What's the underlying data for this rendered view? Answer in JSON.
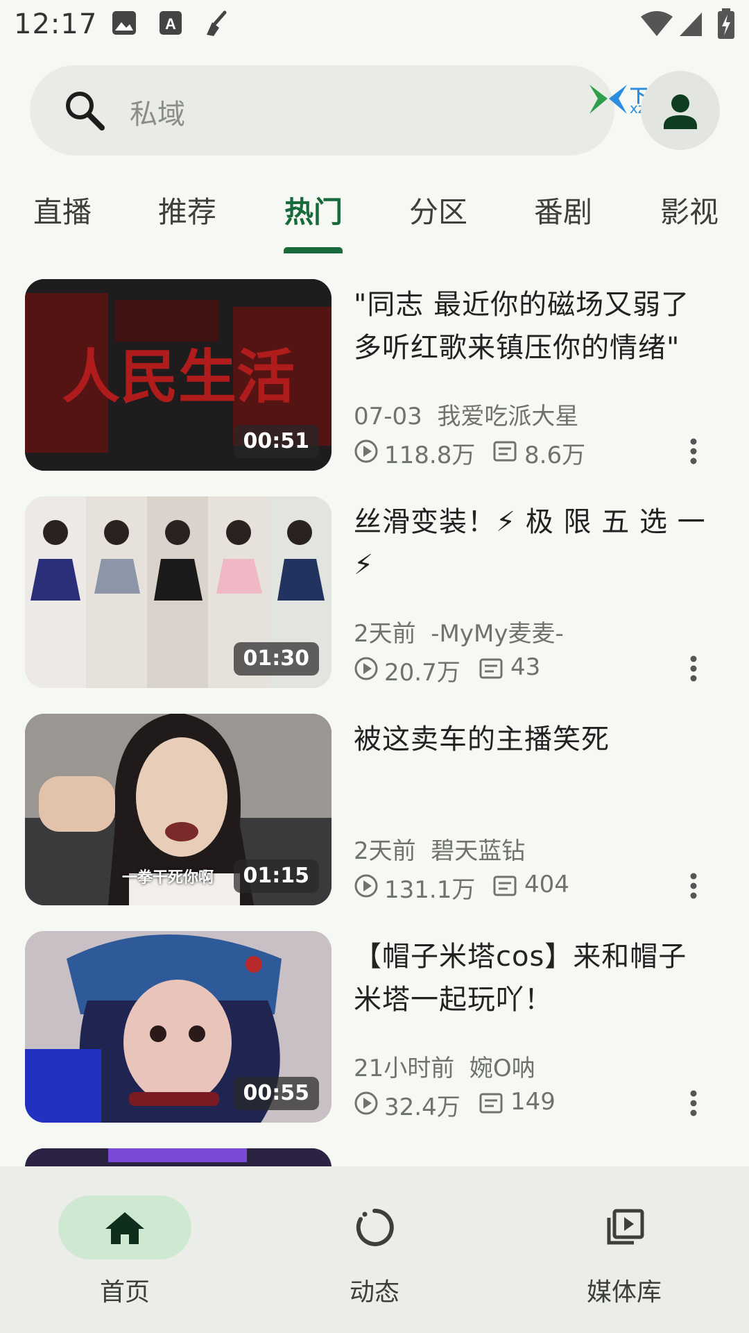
{
  "status_bar": {
    "time": "12:17"
  },
  "search": {
    "placeholder": "私域"
  },
  "watermark": {
    "title": "下载集",
    "url": "xzji.com"
  },
  "tabs": [
    {
      "label": "直播"
    },
    {
      "label": "推荐"
    },
    {
      "label": "热门",
      "active": true
    },
    {
      "label": "分区"
    },
    {
      "label": "番剧"
    },
    {
      "label": "影视"
    }
  ],
  "videos": [
    {
      "title": "\"同志 最近你的磁场又弱了 多听红歌来镇压你的情绪\"",
      "date": "07-03",
      "author": "我爱吃派大星",
      "views": "118.8万",
      "danmaku": "8.6万",
      "duration": "00:51",
      "thumb_text": "人民生活"
    },
    {
      "title": "丝滑变装！⚡ 极 限 五 选 一 ⚡",
      "date": "2天前",
      "author": "-MyMy麦麦-",
      "views": "20.7万",
      "danmaku": "43",
      "duration": "01:30"
    },
    {
      "title": "被这卖车的主播笑死",
      "date": "2天前",
      "author": "碧天蓝钻",
      "views": "131.1万",
      "danmaku": "404",
      "duration": "01:15",
      "thumb_text": "一拳干死你啊"
    },
    {
      "title": "【帽子米塔cos】来和帽子米塔一起玩吖！",
      "date": "21小时前",
      "author": "婉O呐",
      "views": "32.4万",
      "danmaku": "149",
      "duration": "00:55"
    }
  ],
  "bottom_nav": [
    {
      "label": "首页",
      "icon": "home-icon",
      "active": true
    },
    {
      "label": "动态",
      "icon": "activity-icon"
    },
    {
      "label": "媒体库",
      "icon": "library-icon"
    }
  ],
  "colors": {
    "accent": "#196a3b",
    "nav_active_pill": "#cfe8d2"
  }
}
